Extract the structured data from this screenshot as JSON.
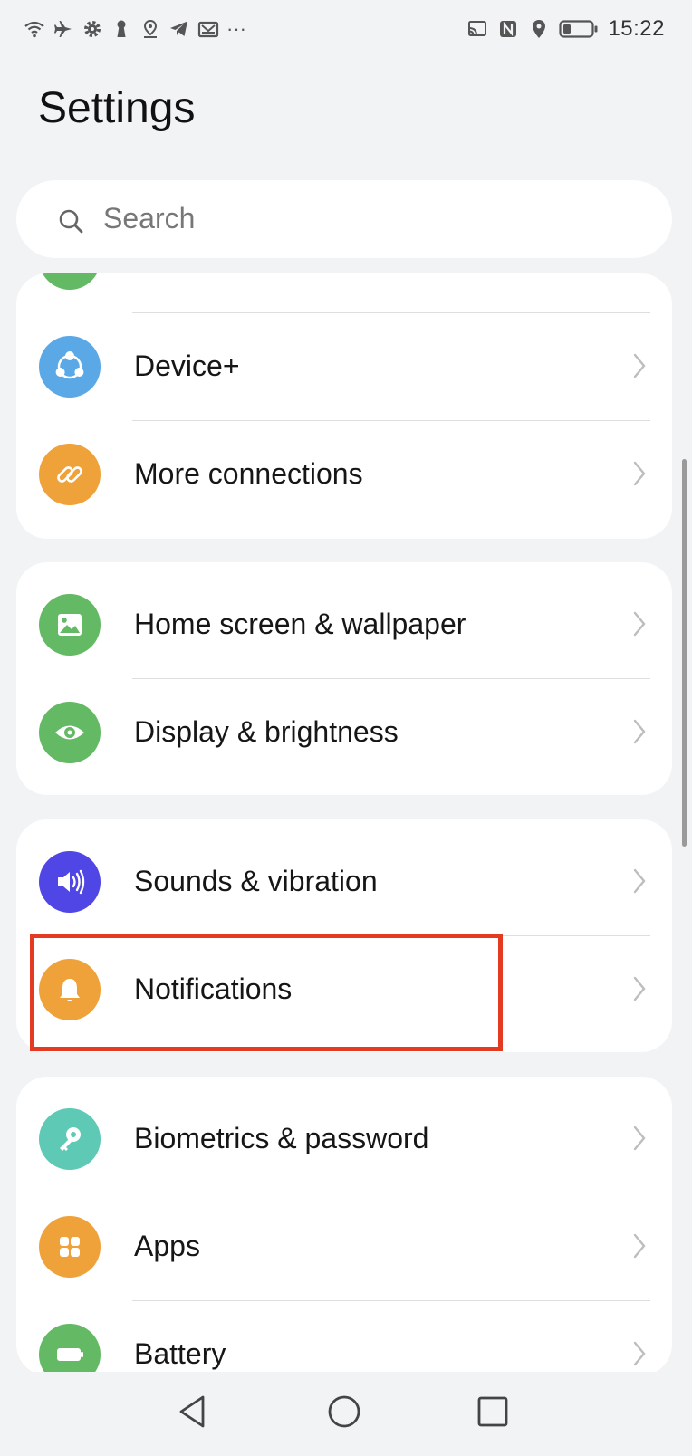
{
  "status_bar": {
    "left_icons": [
      "wifi-icon",
      "airplane-icon",
      "gear-icon",
      "keyhole-icon",
      "location-pin-icon",
      "telegram-icon",
      "mail-icon"
    ],
    "more": "···",
    "right_icons": [
      "cast-icon",
      "nfc-icon",
      "location-icon",
      "battery-icon"
    ],
    "time": "15:22"
  },
  "title": "Settings",
  "search": {
    "placeholder": "Search"
  },
  "groups": [
    {
      "items": [
        {
          "label": "Device+",
          "icon": "device-plus-icon",
          "color": "#5aa8e6"
        },
        {
          "label": "More connections",
          "icon": "link-icon",
          "color": "#f0a23a"
        }
      ]
    },
    {
      "items": [
        {
          "label": "Home screen & wallpaper",
          "icon": "image-icon",
          "color": "#64b964"
        },
        {
          "label": "Display & brightness",
          "icon": "eye-icon",
          "color": "#64b964"
        }
      ]
    },
    {
      "items": [
        {
          "label": "Sounds & vibration",
          "icon": "speaker-icon",
          "color": "#4f46e5"
        },
        {
          "label": "Notifications",
          "icon": "bell-icon",
          "color": "#f0a23a"
        }
      ]
    },
    {
      "items": [
        {
          "label": "Biometrics & password",
          "icon": "key-icon",
          "color": "#5ec9b4"
        },
        {
          "label": "Apps",
          "icon": "apps-grid-icon",
          "color": "#f0a23a"
        },
        {
          "label": "Battery",
          "icon": "battery-icon",
          "color": "#64b964"
        }
      ]
    }
  ],
  "highlight_color": "#e53a22",
  "nav": [
    "back-icon",
    "home-icon",
    "recents-icon"
  ]
}
